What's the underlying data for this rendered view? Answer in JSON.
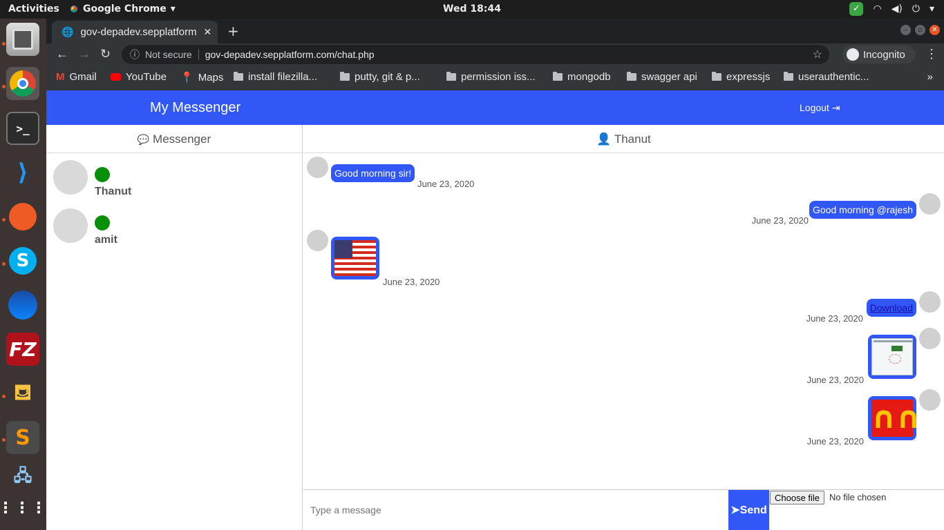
{
  "os": {
    "activities": "Activities",
    "app_name": "Google Chrome",
    "clock": "Wed 18:44"
  },
  "browser": {
    "tab_title": "gov-depadev.sepplatform",
    "security": "Not secure",
    "url": "gov-depadev.sepplatform.com/chat.php",
    "incognito": "Incognito",
    "bookmarks": [
      "Gmail",
      "YouTube",
      "Maps",
      "install filezilla...",
      "putty,  git & p...",
      "permission iss...",
      "mongodb",
      "swagger api",
      "expressjs",
      "userauthentic..."
    ]
  },
  "app": {
    "brand": "My Messenger",
    "logout": "Logout",
    "left_header": "Messenger",
    "right_header": "Thanut",
    "contacts": [
      {
        "name": "Thanut",
        "status_color": "#089108"
      },
      {
        "name": "amit",
        "status_color": "#089108"
      }
    ],
    "messages": [
      {
        "side": "left",
        "type": "text",
        "text": "Good morning sir!",
        "date": "June 23, 2020"
      },
      {
        "side": "right",
        "type": "text",
        "text": "Good morning @rajesh",
        "date": "June 23, 2020"
      },
      {
        "side": "left",
        "type": "image",
        "image": "us-flag",
        "date": "June 23, 2020"
      },
      {
        "side": "right",
        "type": "link",
        "text": "Download",
        "date": "June 23, 2020"
      },
      {
        "side": "right",
        "type": "image",
        "image": "screenshot-thumbnail",
        "date": "June 23, 2020"
      },
      {
        "side": "right",
        "type": "image",
        "image": "mcdonalds-logo",
        "date": "June 23, 2020"
      }
    ],
    "composer": {
      "placeholder": "Type a message",
      "send_label": "Send",
      "choose_file": "Choose file",
      "no_file": "No file chosen"
    },
    "accent_color": "#3157f7"
  }
}
